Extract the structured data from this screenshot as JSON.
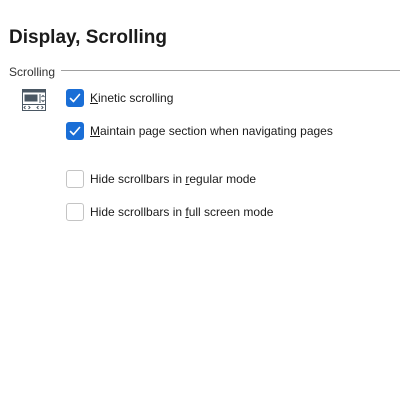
{
  "page": {
    "title": "Display, Scrolling"
  },
  "section": {
    "label": "Scrolling",
    "icon": "scrollbar-settings-icon"
  },
  "options": [
    {
      "pre": "",
      "mnemonic": "K",
      "post": "inetic scrolling",
      "checked": true
    },
    {
      "pre": "",
      "mnemonic": "M",
      "post": "aintain page section when navigating pages",
      "checked": true
    },
    {
      "pre": "Hide scrollbars in ",
      "mnemonic": "r",
      "post": "egular mode",
      "checked": false
    },
    {
      "pre": "Hide scrollbars in ",
      "mnemonic": "f",
      "post": "ull screen mode",
      "checked": false
    }
  ],
  "colors": {
    "checkbox_checked": "#1a6ed6",
    "checkbox_border": "#c4c4c4",
    "text": "#1b1b1b"
  }
}
